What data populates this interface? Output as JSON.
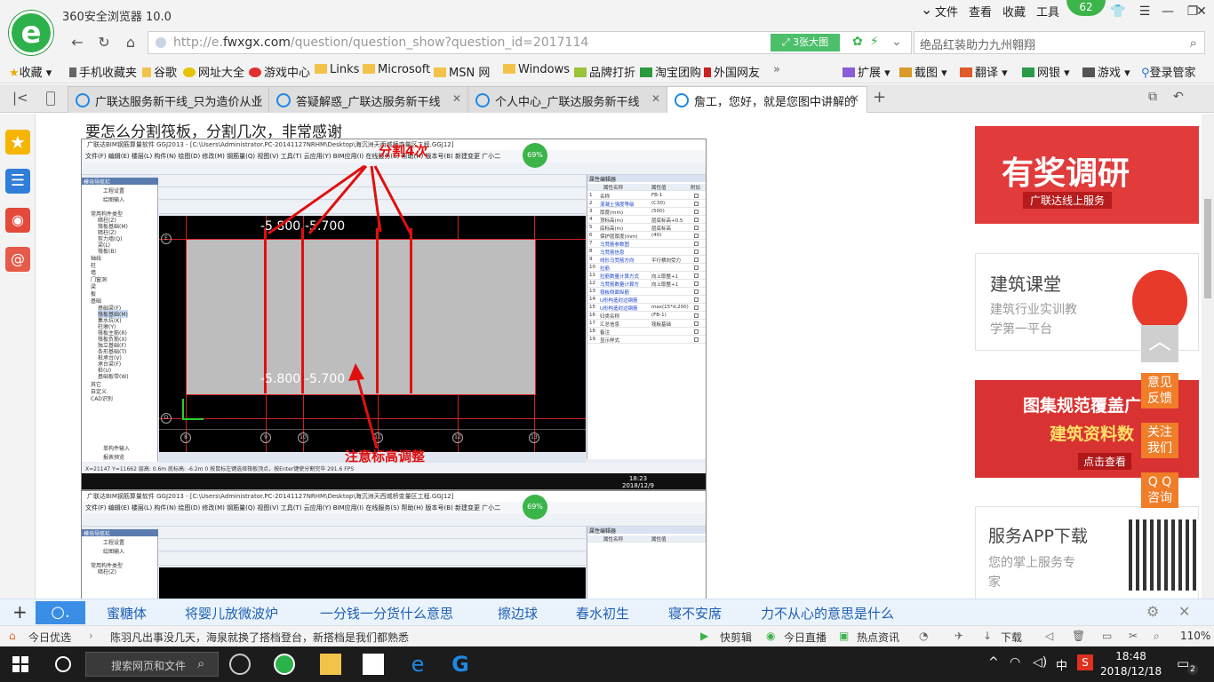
{
  "app": {
    "title": "360安全浏览器 10.0",
    "logo_letter": "e"
  },
  "top_menu": {
    "file": "文件",
    "view": "查看",
    "favorites": "收藏",
    "tools": "工具",
    "badge": "62"
  },
  "nav": {
    "url_prefix": "http://e.",
    "url_domain": "fwxgx.com",
    "url_path": "/question/question_show?question_id=2017114",
    "images_button": "3张大图",
    "search_text": "绝品红装助力九州翱翔"
  },
  "bookmarks": [
    "收藏",
    "手机收藏夹",
    "谷歌",
    "网址大全",
    "游戏中心",
    "Links",
    "Microsoft",
    "MSN 网",
    "Windows",
    "品牌打折",
    "淘宝团购",
    "外国网友"
  ],
  "bookmarks_right": [
    "扩展",
    "截图",
    "翻译",
    "网银",
    "游戏",
    "登录管家"
  ],
  "tabs": [
    {
      "label": "广联达服务新干线_只为造价从业"
    },
    {
      "label": "答疑解惑_广联达服务新干线"
    },
    {
      "label": "个人中心_广联达服务新干线"
    },
    {
      "label": "詹工，您好，就是您图中讲解的"
    }
  ],
  "question_text": "要怎么分割筏板，分割几次，非常感谢",
  "screenshot1": {
    "title": "广联达BIM钢筋算量软件 GGJ2013 - [C:\\Users\\Administrator.PC-20141127NRHM\\Desktop\\海沉洲天西城桥变量区工程.GGJ12]",
    "menu": "文件(F)  编辑(E)  楼层(L)  构件(N)  绘图(D)  修改(M)  钢筋量(Q)  视图(V)  工具(T)  云应用(Y)  BIM应用(I)  在线服务(S)  帮助(H)  版本号(B)  新建变更  广小二",
    "tree_title": "模块导航栏",
    "tree_items": [
      "工程设置",
      "绘图输入",
      "常用构件类型",
      "暗柱(Z)",
      "筏板基础(M)",
      "暗柱(Z)",
      "剪力墙(Q)",
      "梁(L)",
      "筏板(B)",
      "轴线",
      "柱",
      "墙",
      "门窗洞",
      "梁",
      "板",
      "基础",
      "基础梁(F)",
      "筏板基础(M)",
      "集水坑(K)",
      "柱墩(Y)",
      "筏板主筋(R)",
      "筏板负筋(X)",
      "独立基础(F)",
      "条形基础(T)",
      "桩承台(V)",
      "承台梁(F)",
      "桩(U)",
      "基础板带(W)",
      "其它",
      "自定义",
      "CAD识别"
    ],
    "tree_bottom": [
      "单构件输入",
      "报表预览"
    ],
    "canvas_labels": {
      "top": "-5.800",
      "top2": "-5.700",
      "bottom": "-5.800",
      "bottom2": "-5.700"
    },
    "grid_top": [
      "8",
      "9",
      "10",
      "11",
      "12",
      "13"
    ],
    "grid_side": [
      "E",
      "D"
    ],
    "props_title": "属性编辑器",
    "props_header": [
      "属性名称",
      "属性值",
      "附加"
    ],
    "props": [
      [
        "1",
        "名称",
        "FB-1"
      ],
      [
        "2",
        "混凝土强度等级",
        "(C30)"
      ],
      [
        "3",
        "厚度(mm)",
        "(500)"
      ],
      [
        "4",
        "顶标高(m)",
        "层底标高+0.5"
      ],
      [
        "5",
        "底标高(m)",
        "层底标高"
      ],
      [
        "6",
        "保护层厚度(mm)",
        "(40)"
      ],
      [
        "7",
        "马凳筋参数图",
        ""
      ],
      [
        "8",
        "马凳筋信息",
        ""
      ],
      [
        "9",
        "线形马凳筋方向",
        "平行横向受力"
      ],
      [
        "10",
        "拉筋",
        ""
      ],
      [
        "11",
        "拉筋数量计算方式",
        "向上取整+1"
      ],
      [
        "12",
        "马凳筋数量计算方",
        "向上取整+1"
      ],
      [
        "13",
        "筏板侧面纵筋",
        ""
      ],
      [
        "14",
        "U形构造封边钢筋",
        ""
      ],
      [
        "15",
        "U形构造封边钢筋",
        "max(15*d,200)"
      ],
      [
        "16",
        "归类名称",
        "(FB-1)"
      ],
      [
        "17",
        "汇总信息",
        "筏板基础"
      ],
      [
        "18",
        "备注",
        ""
      ],
      [
        "19",
        "显示样式",
        ""
      ]
    ],
    "status": "X=21147  Y=11662      层高: 0.6m   底标高: -6.2m   0        按鼠标左键选择筏板顶点，按Enter键使分割完毕         291.6 FPS",
    "clock_time": "18:23",
    "clock_date": "2018/12/9",
    "annotation_top": "分割4次",
    "annotation_bottom": "注意标高调整",
    "percent": "69%"
  },
  "screenshot2": {
    "title": "广联达BIM钢筋算量软件 GGJ2013 - [C:\\Users\\Administrator.PC-20141127NRHM\\Desktop\\海沉洲天西城桥变量区工程.GGJ12]",
    "percent": "69%"
  },
  "ads": {
    "ad1_title": "有奖调研",
    "ad1_sub": "广联达线上服务",
    "ad2_title": "建筑课堂",
    "ad2_sub1": "建筑行业实训教",
    "ad2_sub2": "学第一平台",
    "ad3_title": "图集规范覆盖广",
    "ad3_sub": "建筑资料数",
    "ad3_btn": "点击查看",
    "ad4_title": "服务APP下载",
    "ad4_sub1": "您的掌上服务专",
    "ad4_sub2": "家"
  },
  "float_buttons": {
    "feedback1": "意见",
    "feedback2": "反馈",
    "follow1": "关注",
    "follow2": "我们",
    "qq1": "Q Q",
    "qq2": "咨询"
  },
  "hot_words": [
    "蜜糖体",
    "将婴儿放微波炉",
    "一分钱一分货什么意思",
    "擦边球",
    "春水初生",
    "寝不安席",
    "力不从心的意思是什么"
  ],
  "status_bar": {
    "today": "今日优选",
    "news": "陈羽凡出事没几天，海泉就换了搭档登台，新搭档是我们都熟悉",
    "quick_edit": "快剪辑",
    "live": "今日直播",
    "hot_news": "热点资讯",
    "download": "下载",
    "zoom": "110%"
  },
  "taskbar": {
    "search": "搜索网页和文件",
    "time": "18:48",
    "date": "2018/12/18",
    "ime": "中",
    "notif": "2"
  },
  "colors": {
    "annotation": "#e01010",
    "accent": "#2db14a",
    "link": "#1f5fb5",
    "float": "#f07d28"
  }
}
